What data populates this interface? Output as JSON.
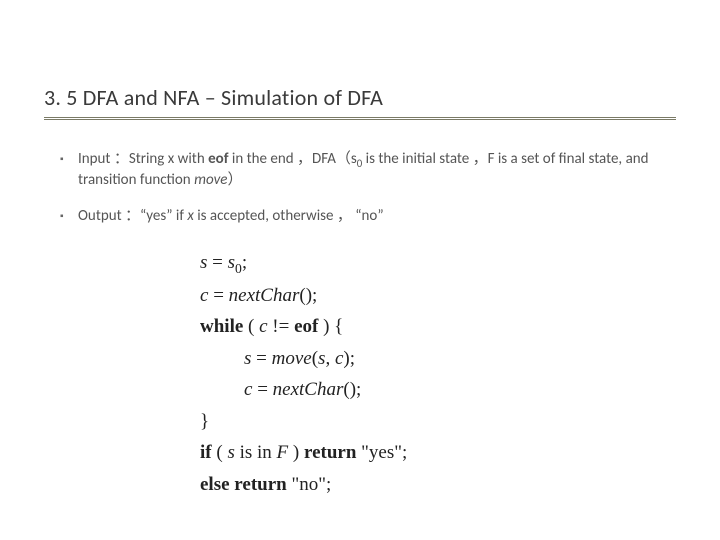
{
  "title": "3. 5 DFA and NFA – Simulation of DFA",
  "bullets": {
    "input": {
      "pre": "Input ：String x with ",
      "eof": "eof",
      "mid1": " in the end ，DFA（s",
      "sub0": "0",
      "mid2": " is the initial state ，F is a set of final state, and transition function ",
      "move": "move",
      "post": "）"
    },
    "output": {
      "pre": "Output ：“yes”  if ",
      "x": "x",
      "post": " is accepted, otherwise ， “no”"
    }
  },
  "code": {
    "l1_s": "s",
    "l1_eq": " = ",
    "l1_s0": "s",
    "l1_sub0": "0",
    "l1_semi": ";",
    "l2_c": "c",
    "l2_eq": " = ",
    "l2_fn": "nextChar",
    "l2_paren": "();",
    "l3_while": "while",
    "l3_open": " ( ",
    "l3_c": "c",
    "l3_neq": " != ",
    "l3_eof": "eof",
    "l3_close": " ) {",
    "l4_s": "s",
    "l4_eq": " = ",
    "l4_fn": "move",
    "l4_open": "(",
    "l4_arg1": "s",
    "l4_comma": ", ",
    "l4_arg2": "c",
    "l4_close": ");",
    "l5_c": "c",
    "l5_eq": " = ",
    "l5_fn": "nextChar",
    "l5_paren": "();",
    "l6_brace": "}",
    "l7_if": "if",
    "l7_open": " ( ",
    "l7_s": "s",
    "l7_isin": " is in ",
    "l7_F": "F",
    "l7_close": " ) ",
    "l7_return": "return",
    "l7_yes": " \"yes\";",
    "l8_else": "else",
    "l8_return": " return",
    "l8_no": " \"no\";"
  }
}
